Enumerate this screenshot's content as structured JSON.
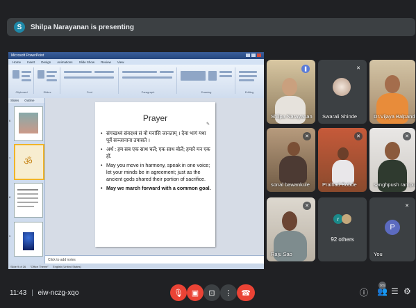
{
  "presentation": {
    "presenter_initial": "S",
    "presenting_text": "Shilpa Narayanan is presenting"
  },
  "powerpoint": {
    "window_title": "Microsoft PowerPoint",
    "menu": [
      "Home",
      "Insert",
      "Design",
      "Animations",
      "Slide Show",
      "Review",
      "View"
    ],
    "panel_tabs": [
      "Slides",
      "Outline"
    ],
    "ribbon_groups": [
      "Clipboard",
      "Slides",
      "Font",
      "Paragraph",
      "Drawing",
      "Editing"
    ],
    "notes_placeholder": "Click to add notes",
    "status": [
      "Slide 9 of 26",
      "\"Office Theme\"",
      "English (United States)"
    ],
    "thumb_numbers": [
      "6",
      "7",
      "8",
      "9"
    ]
  },
  "slide": {
    "title": "Prayer",
    "bullets": [
      {
        "text": "संगच्छध्वं संवदध्वं सं वो मनांसि जानताम् । देवा भागं यथा पूर्वे सञ्जानाना उपासते ।",
        "bold": false
      },
      {
        "text": "अर्थ : हम सब एक साथ चलें; एक साथ बोलें; हमारे मन एक हों.",
        "bold": false
      },
      {
        "text": "May you move in harmony, speak in one voice; let your minds be in agreement; just as the ancient gods shared their portion of sacrifice.",
        "bold": false
      },
      {
        "text": "May we march forward with a common goal.",
        "bold": true
      }
    ]
  },
  "participants": [
    {
      "name": "Shilpa Narayanan",
      "muted": false,
      "speaking": true
    },
    {
      "name": "Swarali Shinde",
      "muted": true
    },
    {
      "name": "Dr.Vijaya Balpande",
      "muted": false
    },
    {
      "name": "sonal bawankule",
      "muted": true
    },
    {
      "name": "Pralhad Bobde",
      "muted": true
    },
    {
      "name": "sanghpush rampure",
      "muted": true
    },
    {
      "name": "Raju Sao",
      "muted": true
    },
    {
      "name": "92 others",
      "muted": false
    },
    {
      "name": "You",
      "initial": "P",
      "muted": true
    }
  ],
  "others_initial": "r",
  "meeting": {
    "time": "11:43",
    "separator": "|",
    "code": "eiw-nczg-xqo",
    "participant_count": "101"
  },
  "colors": {
    "background": "#202124",
    "danger": "#ea4335",
    "control_grey": "#3c4043"
  }
}
